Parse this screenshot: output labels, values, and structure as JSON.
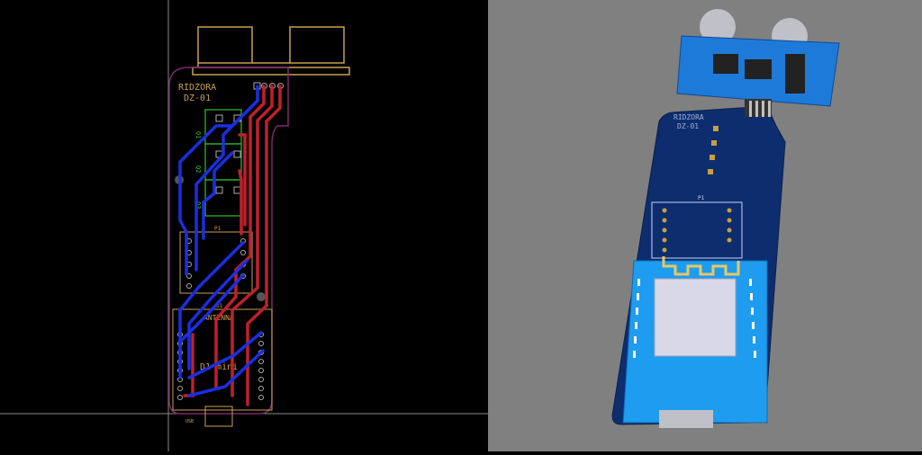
{
  "layout_view": {
    "board_title": "RIDZORA",
    "board_subtitle": "DZ-01",
    "module_label": "D1 mini",
    "antenna_label": "ANTENNA",
    "connector_label": "P1",
    "sensor_label": "U1",
    "q_labels": [
      "Q1",
      "Q2",
      "Q3"
    ],
    "usb_label": "USB"
  },
  "render_view": {
    "board_title": "RIDZORA",
    "board_subtitle": "DZ-01",
    "connector_label": "P1"
  },
  "colors": {
    "top_copper": "#c0202a",
    "bottom_copper": "#1a2fe0",
    "board_outline": "#7a2a6a",
    "silkscreen": "#c8a050",
    "pcb_blue": "#0e2d6e",
    "module_blue": "#1e9cf0"
  }
}
